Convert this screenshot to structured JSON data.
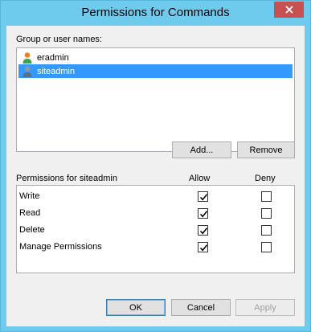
{
  "window": {
    "title": "Permissions for Commands"
  },
  "users": {
    "label": "Group or user names:",
    "items": [
      {
        "name": "eradmin",
        "icon": "user-icon",
        "selected": false
      },
      {
        "name": "siteadmin",
        "icon": "user-icon",
        "selected": true
      }
    ],
    "add_label": "Add...",
    "remove_label": "Remove"
  },
  "permissions": {
    "label": "Permissions for siteadmin",
    "allow_header": "Allow",
    "deny_header": "Deny",
    "rows": [
      {
        "name": "Write",
        "allow": true,
        "deny": false
      },
      {
        "name": "Read",
        "allow": true,
        "deny": false
      },
      {
        "name": "Delete",
        "allow": true,
        "deny": false
      },
      {
        "name": "Manage Permissions",
        "allow": true,
        "deny": false
      }
    ]
  },
  "footer": {
    "ok_label": "OK",
    "cancel_label": "Cancel",
    "apply_label": "Apply"
  },
  "colors": {
    "title_bar": "#6fcbee",
    "close_button": "#c75050",
    "selection": "#3399ff"
  }
}
